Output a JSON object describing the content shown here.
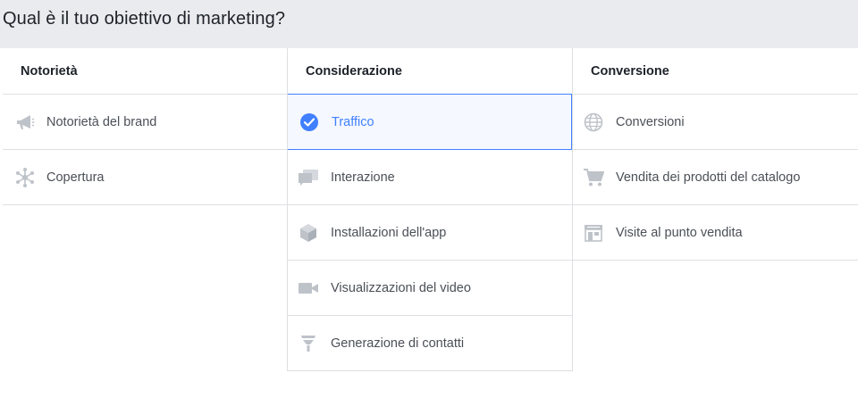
{
  "title": "Qual è il tuo obiettivo di marketing?",
  "columns": [
    {
      "header": "Notorietà",
      "items": [
        {
          "label": "Notorietà del brand",
          "icon": "megaphone-icon",
          "selected": false
        },
        {
          "label": "Copertura",
          "icon": "reach-icon",
          "selected": false
        }
      ]
    },
    {
      "header": "Considerazione",
      "items": [
        {
          "label": "Traffico",
          "icon": "checkmark-icon",
          "selected": true
        },
        {
          "label": "Interazione",
          "icon": "chat-bubbles-icon",
          "selected": false
        },
        {
          "label": "Installazioni dell'app",
          "icon": "cube-icon",
          "selected": false
        },
        {
          "label": "Visualizzazioni del video",
          "icon": "video-camera-icon",
          "selected": false
        },
        {
          "label": "Generazione di contatti",
          "icon": "funnel-icon",
          "selected": false
        }
      ]
    },
    {
      "header": "Conversione",
      "items": [
        {
          "label": "Conversioni",
          "icon": "globe-icon",
          "selected": false
        },
        {
          "label": "Vendita dei prodotti del catalogo",
          "icon": "shopping-cart-icon",
          "selected": false
        },
        {
          "label": "Visite al punto vendita",
          "icon": "store-icon",
          "selected": false
        }
      ]
    }
  ],
  "colors": {
    "accent": "#4080ff",
    "icon": "#bec3c9",
    "border": "#dddfe2",
    "topbar": "#e9ebee"
  }
}
